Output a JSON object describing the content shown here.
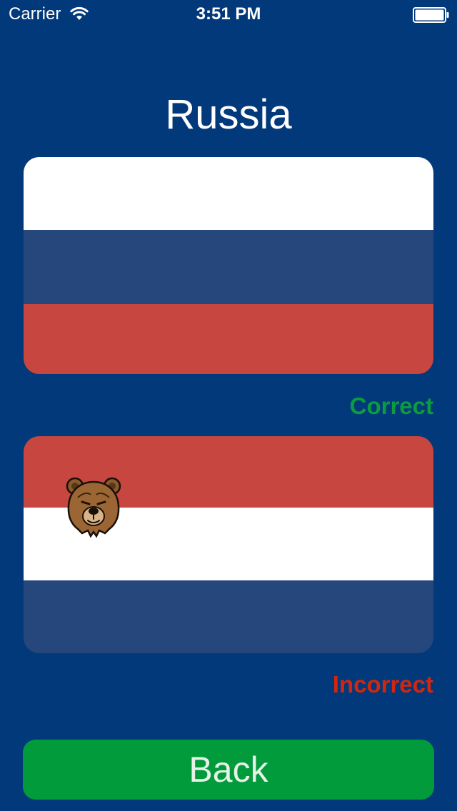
{
  "status_bar": {
    "carrier": "Carrier",
    "time": "3:51 PM"
  },
  "page": {
    "title": "Russia"
  },
  "colors": {
    "background": "#02397a",
    "flag_white": "#ffffff",
    "flag_blue": "#25477c",
    "flag_red": "#c74740",
    "correct": "#0a9c3e",
    "incorrect": "#d3260f",
    "button": "#029b3c",
    "button_text": "#e6f2e8"
  },
  "options": [
    {
      "stripes": [
        "white",
        "blue",
        "red"
      ],
      "has_emblem": false,
      "result": "Correct"
    },
    {
      "stripes": [
        "red",
        "white",
        "blue"
      ],
      "has_emblem": true,
      "emblem_icon": "bear-head-icon",
      "result": "Incorrect"
    }
  ],
  "back_button": {
    "label": "Back"
  }
}
